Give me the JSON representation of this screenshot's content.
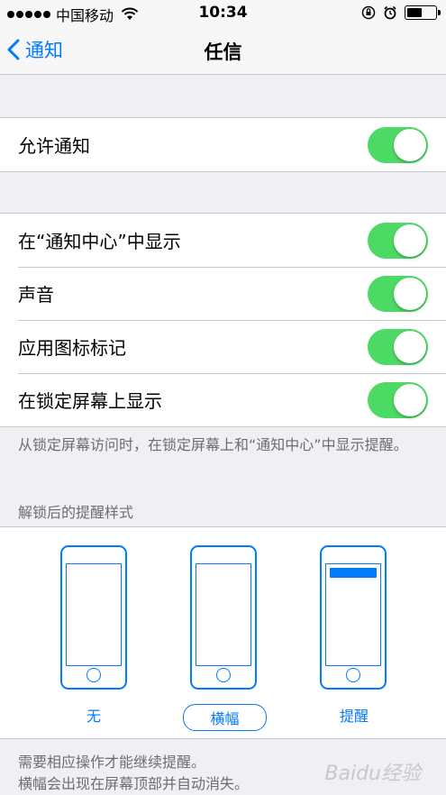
{
  "status_bar": {
    "carrier": "中国移动",
    "time": "10:34",
    "battery_level": 0.55
  },
  "nav": {
    "back_label": "通知",
    "title": "任信"
  },
  "allow_notifications": {
    "label": "允许通知",
    "on": true
  },
  "settings": [
    {
      "label": "在“通知中心”中显示",
      "on": true
    },
    {
      "label": "声音",
      "on": true
    },
    {
      "label": "应用图标标记",
      "on": true
    },
    {
      "label": "在锁定屏幕上显示",
      "on": true
    }
  ],
  "lock_screen_note": "从锁定屏幕访问时，在锁定屏幕上和“通知中心”中显示提醒。",
  "alert_style": {
    "header": "解锁后的提醒样式",
    "options": [
      "无",
      "横幅",
      "提醒"
    ],
    "selected": "横幅"
  },
  "bottom_note": {
    "line1": "需要相应操作才能继续提醒。",
    "line2": "横幅会出现在屏幕顶部并自动消失。"
  },
  "watermark": "Baidu经验",
  "colors": {
    "accent": "#007aff",
    "toggle_on": "#4cd964"
  }
}
